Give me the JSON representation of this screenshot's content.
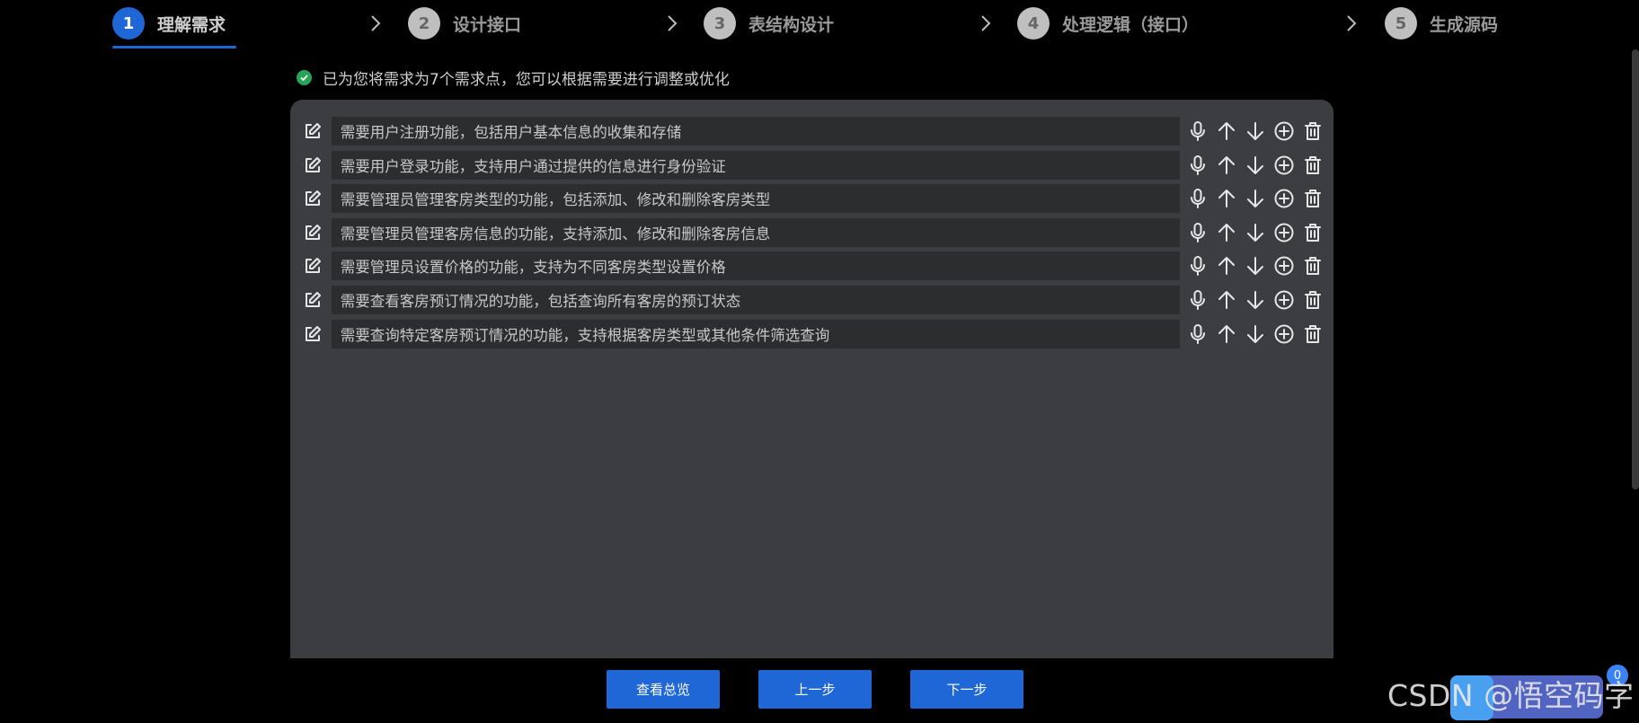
{
  "steps": [
    {
      "num": "1",
      "label": "理解需求",
      "active": true
    },
    {
      "num": "2",
      "label": "设计接口",
      "active": false
    },
    {
      "num": "3",
      "label": "表结构设计",
      "active": false
    },
    {
      "num": "4",
      "label": "处理逻辑（接口）",
      "active": false
    },
    {
      "num": "5",
      "label": "生成源码",
      "active": false
    }
  ],
  "hint": "已为您将需求为7个需求点，您可以根据需要进行调整或优化",
  "requirements": [
    "需要用户注册功能，包括用户基本信息的收集和存储",
    "需要用户登录功能，支持用户通过提供的信息进行身份验证",
    "需要管理员管理客房类型的功能，包括添加、修改和删除客房类型",
    "需要管理员管理客房信息的功能，支持添加、修改和删除客房信息",
    "需要管理员设置价格的功能，支持为不同客房类型设置价格",
    "需要查看客房预订情况的功能，包括查询所有客房的预订状态",
    "需要查询特定客房预订情况的功能，支持根据客房类型或其他条件筛选查询"
  ],
  "buttons": {
    "overview": "查看总览",
    "prev": "上一步",
    "next": "下一步"
  },
  "badge_count": "0",
  "watermark": "CSDN @悟空码字",
  "colors": {
    "accent": "#1f66d6",
    "panel": "#3b3d40",
    "success": "#27a35a"
  }
}
